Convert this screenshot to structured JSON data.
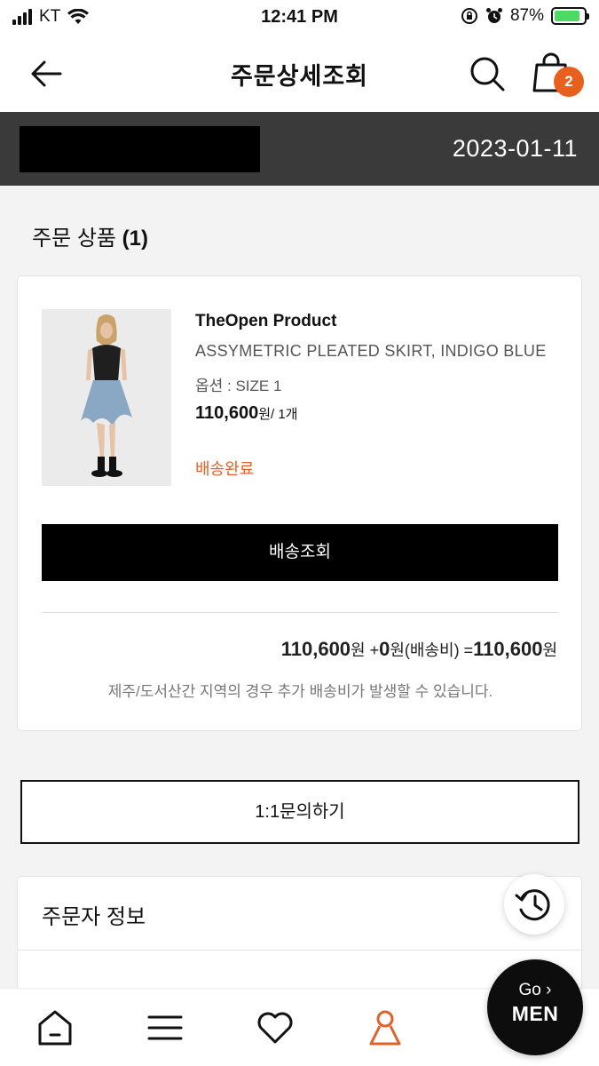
{
  "status_bar": {
    "carrier": "KT",
    "time": "12:41 PM",
    "battery": "87%"
  },
  "header": {
    "title": "주문상세조회",
    "cart_count": "2",
    "icons": [
      "arrow-left-icon",
      "search-icon",
      "shopping-bag-icon"
    ]
  },
  "order": {
    "date": "2023-01-11"
  },
  "order_items": {
    "heading": "주문 상품",
    "count": "(1)",
    "items": [
      {
        "brand": "TheOpen Product",
        "name": "ASSYMETRIC PLEATED SKIRT, INDIGO BLUE",
        "option": "옵션 : SIZE 1",
        "price": "110,600",
        "price_unit": "원/ 1개",
        "status": "배송완료",
        "track_button": "배송조회"
      }
    ],
    "summary": {
      "product_total": "110,600",
      "won": "원",
      "plus": " +",
      "shipping": "0",
      "shipping_label": "원(배송비) =",
      "grand_total": "110,600"
    },
    "notice": "제주/도서산간 지역의 경우 추가 배송비가 발생할 수 있습니다."
  },
  "inquiry_button": "1:1문의하기",
  "orderer": {
    "title": "주문자 정보"
  },
  "floating": {
    "go": "Go ›",
    "men": "MEN"
  },
  "tabbar": {
    "items": [
      "home-icon",
      "menu-icon",
      "heart-icon",
      "user-icon"
    ],
    "active": "user-icon"
  },
  "colors": {
    "accent": "#e8601e",
    "status_delivered": "#e0622a",
    "order_bar": "#3a3a3a"
  }
}
